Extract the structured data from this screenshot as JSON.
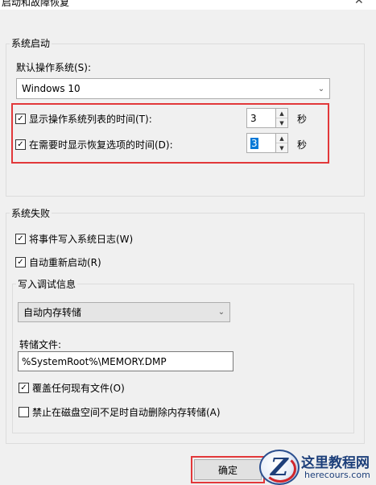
{
  "window": {
    "title": "启动和故障恢复",
    "close_glyph": "✕"
  },
  "startup": {
    "group_label": "系统启动",
    "default_os_label": "默认操作系统(S):",
    "default_os_value": "Windows 10",
    "show_os_list": {
      "label": "显示操作系统列表的时间(T):",
      "checked": true,
      "value": "3",
      "unit": "秒"
    },
    "show_recovery": {
      "label": "在需要时显示恢复选项的时间(D):",
      "checked": true,
      "value": "3",
      "unit": "秒"
    }
  },
  "failure": {
    "group_label": "系统失败",
    "write_event_log": {
      "label": "将事件写入系统日志(W)",
      "checked": true
    },
    "auto_restart": {
      "label": "自动重新启动(R)",
      "checked": true
    },
    "debug": {
      "group_label": "写入调试信息",
      "dump_type_value": "自动内存转储",
      "dump_file_label": "转储文件:",
      "dump_file_value": "%SystemRoot%\\MEMORY.DMP",
      "overwrite": {
        "label": "覆盖任何现有文件(O)",
        "checked": true
      },
      "disable_auto_delete": {
        "label": "禁止在磁盘空间不足时自动删除内存转储(A)",
        "checked": false
      }
    }
  },
  "buttons": {
    "ok": "确定"
  },
  "watermark": {
    "title": "这里教程网",
    "url": "herecours.com",
    "letter": "Z"
  },
  "colors": {
    "highlight_box": "#e2383a",
    "selection": "#0078d7"
  },
  "icons": {
    "check": "✓",
    "chevron_down": "⌄",
    "spin_up": "▲",
    "spin_down": "▼"
  }
}
